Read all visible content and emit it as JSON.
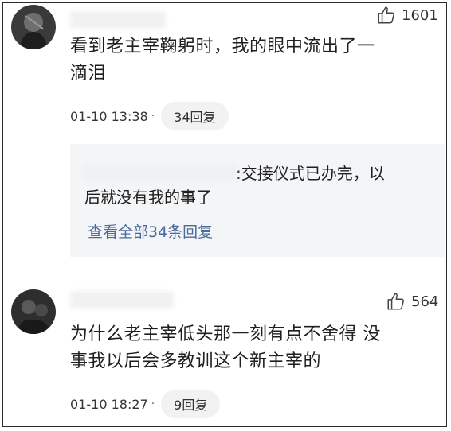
{
  "comments": [
    {
      "likes": "1601",
      "text_line1": "看到老主宰鞠躬时，我的眼中流出了一",
      "text_line2": "滴泪",
      "time": "01-10 13:38",
      "dot": "·",
      "replies": "34回复",
      "reply_preview": {
        "text_line1": ":交接仪式已办完，以",
        "text_line2": "后就没有我的事了",
        "view_all": "查看全部34条回复"
      }
    },
    {
      "likes": "564",
      "text_line1": "为什么老主宰低头那一刻有点不舍得 没",
      "text_line2": "事我以后会多教训这个新主宰的",
      "time": "01-10 18:27",
      "dot": "·",
      "replies": "9回复"
    }
  ],
  "colors": {
    "link": "#4a6a9e",
    "pill_bg": "#f2f2f2",
    "reply_bg": "#f4f5f7"
  },
  "icons": [
    "avatar",
    "thumbs-up-icon"
  ]
}
